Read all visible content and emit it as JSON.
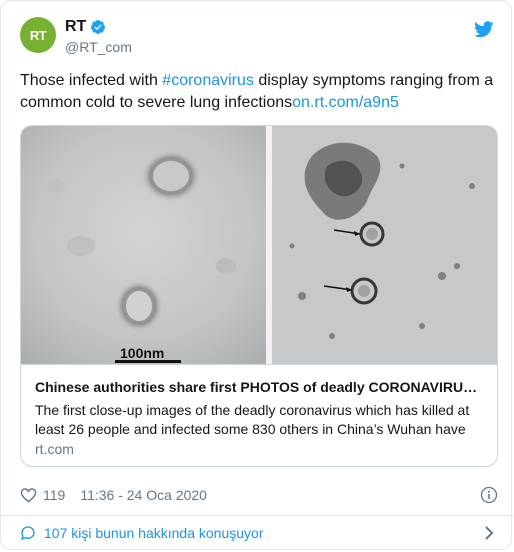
{
  "tweet": {
    "author": {
      "display_name": "RT",
      "handle": "@RT_com",
      "avatar_text": "RT",
      "avatar_color": "#77b033",
      "verified": true
    },
    "text": {
      "before_hashtag": "Those infected with ",
      "hashtag": "#coronavirus",
      "after_hashtag": " display symptoms ranging from a common cold to severe lung infections",
      "link": "on.rt.com/a9n5"
    },
    "media": {
      "scale_label": "100nm"
    },
    "link_card": {
      "title": "Chinese authorities share first PHOTOS of deadly CORONAVIRU…",
      "description": "The first close-up images of the deadly coronavirus which has killed at least 26 people and infected some 830 others in China’s Wuhan have",
      "domain": "rt.com"
    },
    "meta": {
      "like_count": "119",
      "timestamp": "11:36 - 24 Oca 2020"
    },
    "conversation": {
      "label": "107 kişi bunun hakkında konuşuyor"
    }
  },
  "icons": {
    "verified": "verified-badge-icon",
    "brand": "twitter-bird-icon",
    "like": "heart-icon",
    "info": "info-icon",
    "reply": "speech-bubble-icon",
    "chevron": "chevron-right-icon"
  },
  "colors": {
    "accent": "#1b95e0",
    "muted": "#657786",
    "border": "#e1e8ed"
  }
}
